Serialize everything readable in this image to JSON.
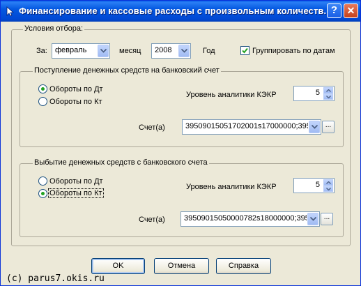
{
  "window": {
    "title": "Финансирование  и кассовые расходы с произвольным количеств...",
    "help_button": "?",
    "close_button": "✕"
  },
  "selection": {
    "legend": "Условия отбора:",
    "period_label": "За:",
    "month_value": "февраль",
    "month_label": "месяц",
    "year_value": "2008",
    "year_label": "Год",
    "group_by_dates_label": "Группировать по датам",
    "group_by_dates_checked": true
  },
  "income": {
    "legend": "Поступление денежных средств на банковский счет",
    "radio_debit_label": "Обороты по Дт",
    "radio_credit_label": "Обороты по Кт",
    "selected": "debit",
    "level_label": "Уровень аналитики КЭКР",
    "level_value": "5",
    "account_label": "Счет(а)",
    "account_value": "39509015051702001s17000000;395"
  },
  "outflow": {
    "legend": "Выбытие денежных средств с банковского счета",
    "radio_debit_label": "Обороты по Дт",
    "radio_credit_label": "Обороты по Кт",
    "selected": "credit",
    "level_label": "Уровень аналитики КЭКР",
    "level_value": "5",
    "account_label": "Счет(а)",
    "account_value": "39509015050000782s18000000;395"
  },
  "buttons": {
    "ok": "OK",
    "cancel": "Отмена",
    "help": "Справка",
    "browse": "..."
  },
  "watermark": "(c) parus7.okis.ru"
}
